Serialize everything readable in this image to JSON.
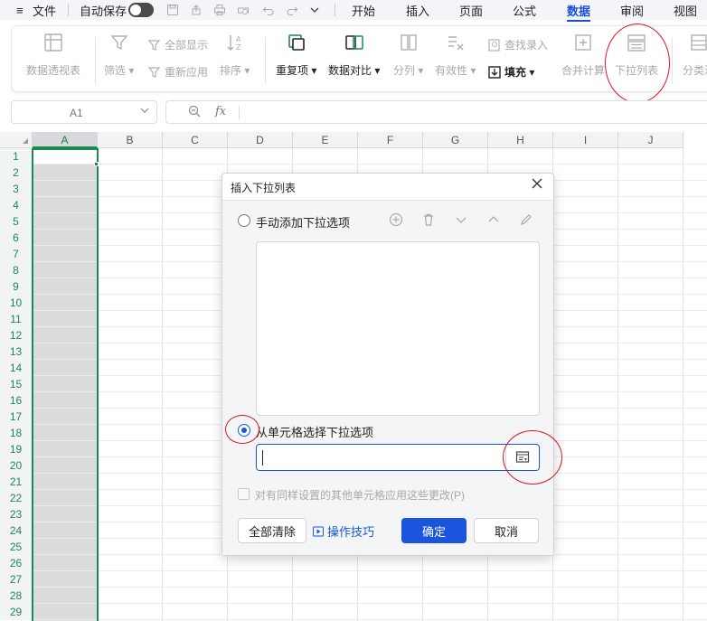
{
  "menubar": {
    "menu_icon": "≡",
    "file_label": "文件",
    "autosave_label": "自动保存",
    "tabs": [
      {
        "label": "开始"
      },
      {
        "label": "插入"
      },
      {
        "label": "页面"
      },
      {
        "label": "公式"
      },
      {
        "label": "数据",
        "active": true
      },
      {
        "label": "审阅"
      },
      {
        "label": "视图"
      }
    ]
  },
  "ribbon": {
    "pivot": "数据透视表",
    "filter": "筛选",
    "show_all": "全部显示",
    "reapply": "重新应用",
    "sort": "排序",
    "duplicates": "重复项",
    "compare": "数据对比",
    "split": "分列",
    "validity": "有效性",
    "lookup_entry": "查找录入",
    "fill": "填充",
    "consolidate": "合并计算",
    "dropdown_list": "下拉列表",
    "subtotal": "分类汇"
  },
  "formula_bar": {
    "cell_ref": "A1",
    "fx": "fx",
    "zoom_icon": "zoom-icon"
  },
  "sheet": {
    "columns": [
      "A",
      "B",
      "C",
      "D",
      "E",
      "F",
      "G",
      "H",
      "I",
      "J"
    ],
    "selected_column": "A",
    "rows": [
      "1",
      "2",
      "3",
      "4",
      "5",
      "6",
      "7",
      "8",
      "9",
      "10",
      "11",
      "12",
      "13",
      "14",
      "15",
      "16",
      "17",
      "18",
      "19",
      "20",
      "21",
      "22",
      "23",
      "24",
      "25",
      "26",
      "27",
      "28",
      "29"
    ]
  },
  "dialog": {
    "title": "插入下拉列表",
    "option_manual": "手动添加下拉选项",
    "option_from_cells": "从单元格选择下拉选项",
    "selected_option": "from_cells",
    "range_value": "",
    "apply_same_label": "对有同样设置的其他单元格应用这些更改(P)",
    "clear_all": "全部清除",
    "tips": "操作技巧",
    "ok": "确定",
    "cancel": "取消"
  },
  "colors": {
    "accent": "#1a55e0",
    "selection": "#1a8a50",
    "annotation": "#e0141e"
  }
}
